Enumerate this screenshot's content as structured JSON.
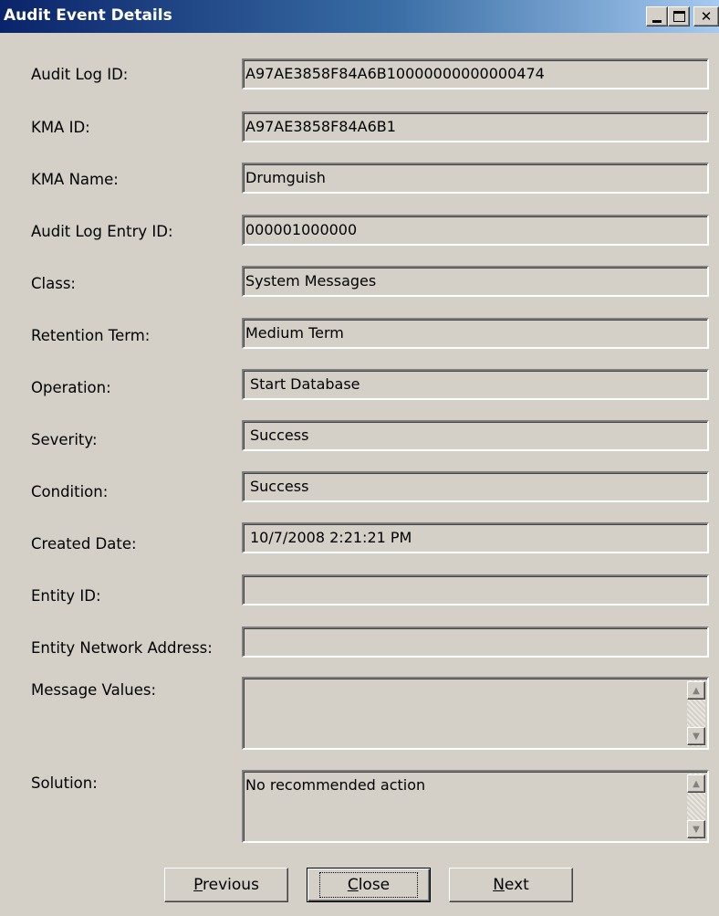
{
  "window": {
    "title": "Audit Event Details",
    "min_label": "_",
    "close_label": "✕"
  },
  "fields": [
    {
      "label": "Audit Log ID:",
      "value": "A97AE3858F84A6B10000000000000474"
    },
    {
      "label": "KMA ID:",
      "value": "A97AE3858F84A6B1"
    },
    {
      "label": "KMA Name:",
      "value": "Drumguish"
    },
    {
      "label": "Audit Log Entry ID:",
      "value": "000001000000"
    },
    {
      "label": "Class:",
      "value": "System Messages"
    },
    {
      "label": "Retention Term:",
      "value": "Medium Term"
    },
    {
      "label": "Operation:",
      "value": "Start Database"
    },
    {
      "label": "Severity:",
      "value": "Success"
    },
    {
      "label": "Condition:",
      "value": "Success"
    },
    {
      "label": "Created Date:",
      "value": "10/7/2008 2:21:21 PM"
    },
    {
      "label": "Entity ID:",
      "value": ""
    },
    {
      "label": "Entity Network Address:",
      "value": ""
    },
    {
      "label": "Message Values:",
      "value": ""
    },
    {
      "label": "Solution:",
      "value": "No recommended action"
    }
  ],
  "buttons": {
    "previous": {
      "mnemonic": "P",
      "rest": "revious"
    },
    "close": {
      "mnemonic": "C",
      "rest": "lose"
    },
    "next": {
      "mnemonic": "N",
      "rest": "ext"
    }
  },
  "scroll": {
    "up_glyph": "▲",
    "down_glyph": "▼"
  }
}
